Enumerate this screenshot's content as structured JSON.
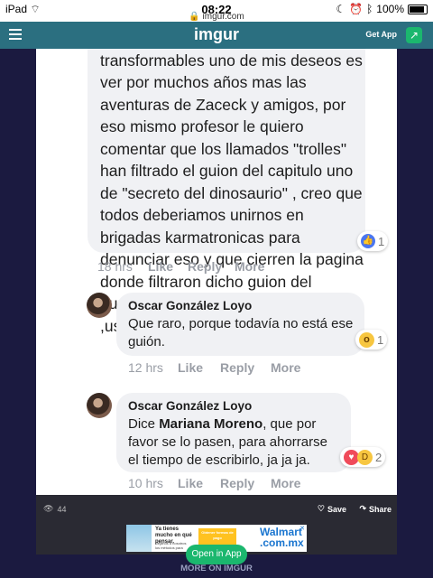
{
  "status": {
    "device": "iPad",
    "time": "08:22",
    "url": "imgur.com",
    "battery": "100%"
  },
  "header": {
    "logo": "imgur",
    "get_app": "Get App"
  },
  "post": {
    "comment1": {
      "text": "de la historieta Karmatron y los transformables uno de mis deseos es ver por muchos años mas las aventuras de Zaceck y amigos, por eso mismo profesor le quiero comentar que los llamados \"trolles\" han filtrado el guion del capitulo uno de \"secreto del dinosaurio\" , creo que todos deberiamos unirnos en brigadas karmatronicas para denunciar eso y que cierren la pagina donde filtraron dicho guion del numero 1 de \"secreto del dinosaurio\" ,usted solo diga \"rana \" y yo brinco",
      "reaction_count": "1",
      "time": "18 hrs",
      "like": "Like",
      "reply": "Reply",
      "more": "More"
    },
    "reply1": {
      "author": "Oscar González Loyo",
      "text": "Que raro, porque todavía no está ese guión.",
      "reaction_count": "1",
      "time": "12 hrs",
      "like": "Like",
      "reply": "Reply",
      "more": "More"
    },
    "reply2": {
      "author": "Oscar González Loyo",
      "text_pre": "Dice ",
      "text_bold": "Mariana Moreno",
      "text_post": ", que por favor se lo pasen, para ahorrarse el tiempo de escribirlo, ja ja ja.",
      "reaction_count": "2",
      "time": "10 hrs",
      "like": "Like",
      "reply": "Reply",
      "more": "More"
    }
  },
  "footer": {
    "views": "44",
    "save": "Save",
    "share": "Share"
  },
  "ad": {
    "headline": "Ya tienes mucho en qué pensar.",
    "sub": "Déjanos a nosotros los métodos para",
    "cta": "Obtener formas de pago",
    "brand": "Walmart",
    "brand2": ".com.mx"
  },
  "open_app": "Open in App",
  "more_on_imgur": "MORE ON IMGUR"
}
